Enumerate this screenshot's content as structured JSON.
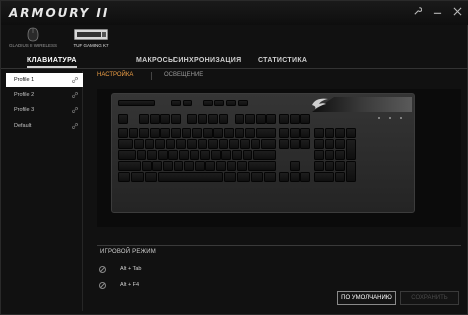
{
  "app": {
    "title": "ARMOURY II"
  },
  "window": {
    "controls": [
      "tools-icon",
      "minimize-icon",
      "close-icon"
    ]
  },
  "devices": [
    {
      "label": "GLADIUS II WIRELESS",
      "icon": "mouse-icon"
    },
    {
      "label": "TUF GAMING K7",
      "icon": "keyboard-icon"
    }
  ],
  "tabs": [
    {
      "label": "КЛАВИАТУРА",
      "active": true
    },
    {
      "label": "МАКРОСЫ",
      "active": false
    },
    {
      "label": "СИНХРОНИЗАЦИЯ",
      "active": false
    },
    {
      "label": "СТАТИСТИКА",
      "active": false
    }
  ],
  "profiles": [
    {
      "label": "Profile 1",
      "selected": true
    },
    {
      "label": "Profile 2",
      "selected": false
    },
    {
      "label": "Profile 3",
      "selected": false
    },
    {
      "label": "Default",
      "selected": false
    }
  ],
  "subtabs": [
    {
      "label": "НАСТРОЙКА",
      "active": true
    },
    {
      "label": "ОСВЕЩЕНИЕ",
      "active": false
    }
  ],
  "game_mode": {
    "title": "ИГРОВОЙ РЕЖИМ",
    "items": [
      {
        "label": "Alt + Tab"
      },
      {
        "label": "Alt + F4"
      }
    ]
  },
  "buttons": {
    "default": "ПО УМОЛЧАНИЮ",
    "save": "СОХРАНИТЬ"
  },
  "colors": {
    "accent": "#f0a046",
    "selected_bg": "#ffffff",
    "background": "#111111"
  }
}
